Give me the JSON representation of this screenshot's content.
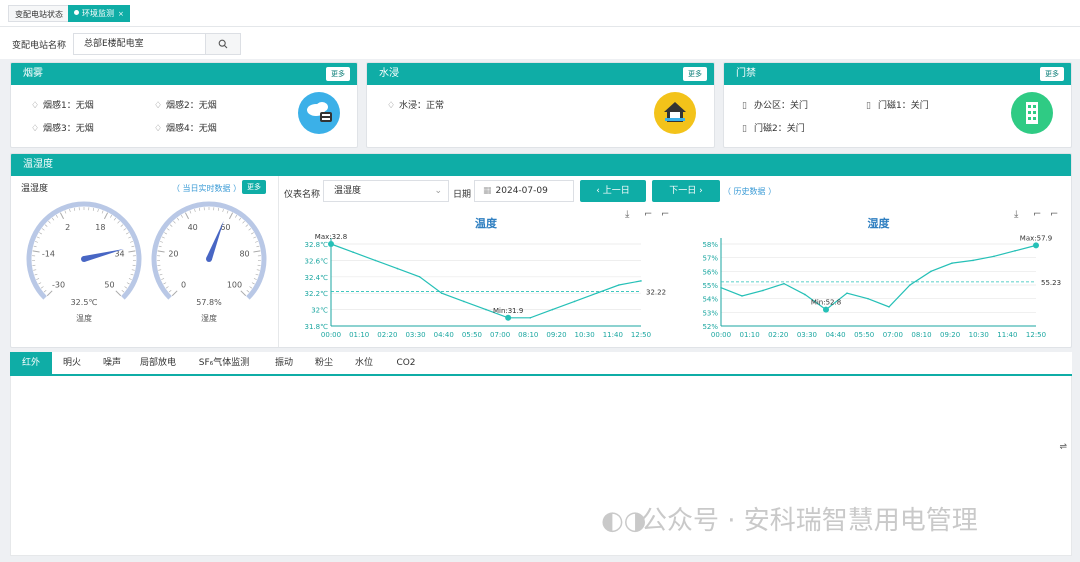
{
  "tabs": [
    {
      "label": "变配电站状态"
    },
    {
      "label": "环境监测",
      "close": "×"
    }
  ],
  "station": {
    "label": "变配电站名称",
    "value": "总部E楼配电室"
  },
  "cards": {
    "smoke": {
      "title": "烟雾",
      "more": "更多",
      "items": [
        "烟感1：无烟",
        "烟感2：无烟",
        "烟感3：无烟",
        "烟感4：无烟"
      ],
      "color": "#3bb0e8"
    },
    "water": {
      "title": "水浸",
      "more": "更多",
      "items": [
        "水浸：正常"
      ],
      "color": "#f3c31a"
    },
    "door": {
      "title": "门禁",
      "more": "更多",
      "items": [
        "办公区：关门",
        "门磁1：关门",
        "门磁2：关门"
      ],
      "color": "#2fcb84"
    }
  },
  "th": {
    "title": "温湿度",
    "subtitle": "温湿度",
    "realtime": "（ 当日实时数据 ）",
    "more": "更多",
    "meter_label": "仪表名称",
    "meter_value": "温湿度",
    "date_label": "日期",
    "date_value": "2024-07-09",
    "prev": "上一日",
    "next": "下一日",
    "history": "（ 历史数据 ）"
  },
  "gauges": [
    {
      "name": "温度",
      "value": 32.5,
      "unit": "℃",
      "value_text": "32.5℃",
      "min": -30,
      "max": 50,
      "ticks": [
        "-30",
        "-14",
        "2",
        "18",
        "34",
        "50"
      ]
    },
    {
      "name": "湿度",
      "value": 57.8,
      "unit": "%",
      "value_text": "57.8%",
      "min": 0,
      "max": 100,
      "ticks": [
        "0",
        "20",
        "40",
        "60",
        "80",
        "100"
      ]
    }
  ],
  "chart_data": [
    {
      "type": "line",
      "title": "温度",
      "x": [
        "00:00",
        "01:10",
        "02:20",
        "03:30",
        "04:40",
        "05:50",
        "07:00",
        "08:10",
        "09:20",
        "10:30",
        "11:40",
        "12:50"
      ],
      "yticks": [
        "31.8℃",
        "32℃",
        "32.2℃",
        "32.4℃",
        "32.6℃",
        "32.8℃"
      ],
      "ylim": [
        31.8,
        32.8
      ],
      "values": [
        32.8,
        32.7,
        32.6,
        32.5,
        32.4,
        32.2,
        32.1,
        32.0,
        31.9,
        31.9,
        32.0,
        32.1,
        32.2,
        32.3,
        32.35
      ],
      "max_label": "Max:32.8",
      "min_label": "Min:31.9",
      "avg": 32.22,
      "avg_label": "32.22"
    },
    {
      "type": "line",
      "title": "湿度",
      "x": [
        "00:00",
        "01:10",
        "02:20",
        "03:30",
        "04:40",
        "05:50",
        "07:00",
        "08:10",
        "09:20",
        "10:30",
        "11:40",
        "12:50"
      ],
      "yticks": [
        "52%",
        "53%",
        "54%",
        "55%",
        "56%",
        "57%",
        "58%"
      ],
      "ylim": [
        52,
        58
      ],
      "values": [
        54.8,
        54.2,
        54.6,
        55.1,
        54.3,
        53.2,
        54.4,
        54.0,
        53.4,
        55.0,
        56.0,
        56.6,
        56.8,
        57.1,
        57.5,
        57.9
      ],
      "max_label": "Max:57.9",
      "min_label": "Min:52.8",
      "avg": 55.23,
      "avg_label": "55.23"
    }
  ],
  "bottom_tabs": [
    "红外",
    "明火",
    "噪声",
    "局部放电",
    "SF₆气体监测",
    "振动",
    "粉尘",
    "水位",
    "CO2"
  ],
  "watermark": "公众号 · 安科瑞智慧用电管理"
}
